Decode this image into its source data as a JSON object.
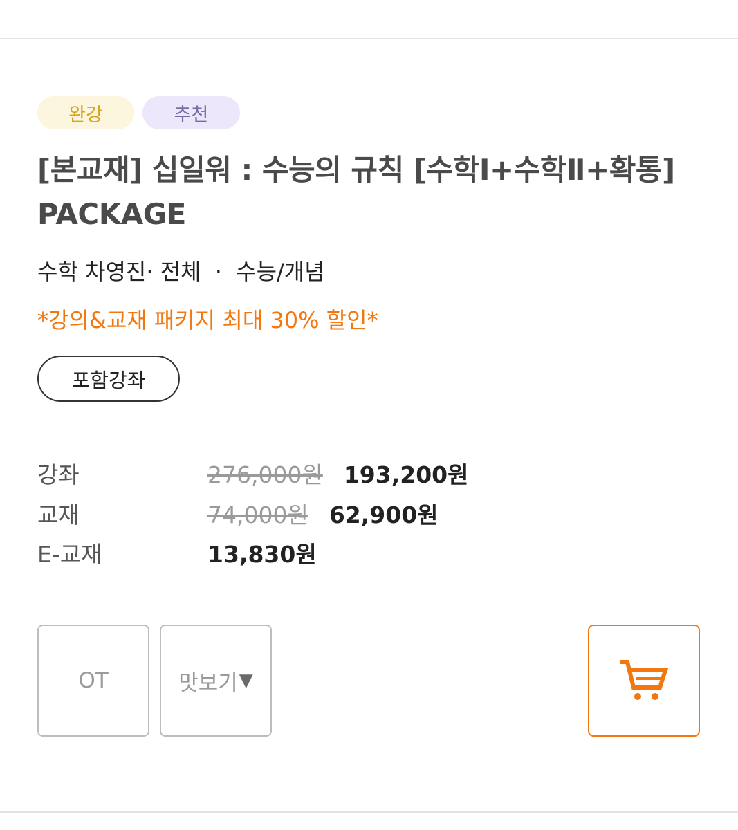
{
  "badges": {
    "complete": "완강",
    "recommend": "추천"
  },
  "title": "[본교재] 십일워 : 수능의 규칙 [수학Ⅰ+수학Ⅱ+확통] PACKAGE",
  "meta": {
    "subject_teacher": "수학 차영진",
    "scope": "전체",
    "category": "수능/개념",
    "separator": "·"
  },
  "promo": "*강의&교재 패키지 최대 30% 할인*",
  "included_button": "포함강좌",
  "prices": [
    {
      "label": "강좌",
      "original": "276,000원",
      "final": "193,200원"
    },
    {
      "label": "교재",
      "original": "74,000원",
      "final": "62,900원"
    },
    {
      "label": "E-교재",
      "original": "",
      "final": "13,830원"
    }
  ],
  "buttons": {
    "ot": "OT",
    "preview": "맛보기",
    "preview_caret": "▼",
    "cart_icon": "cart-icon"
  },
  "colors": {
    "accent_orange": "#f2770f",
    "badge_complete_bg": "#fbf6dd",
    "badge_complete_text": "#d9a21c",
    "badge_recommend_bg": "#ece7fa",
    "badge_recommend_text": "#7a6aa6"
  }
}
